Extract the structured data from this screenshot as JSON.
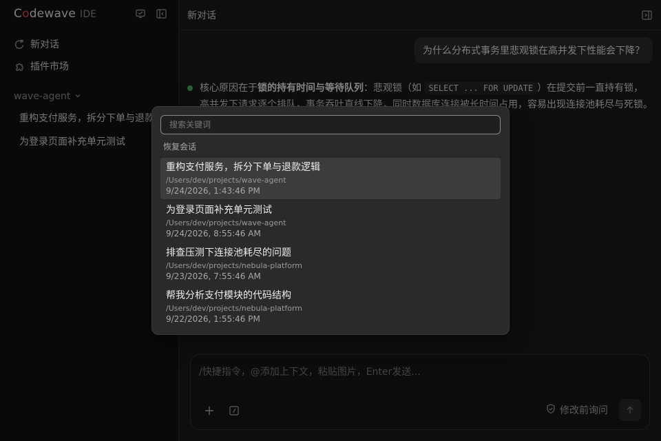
{
  "app": {
    "logo_c": "C",
    "logo_o": "o",
    "logo_rest": "dewave",
    "logo_suffix": "IDE"
  },
  "sidebar": {
    "nav": [
      {
        "label": "新对话",
        "icon": "new-chat-icon"
      },
      {
        "label": "插件市场",
        "icon": "puzzle-icon"
      }
    ],
    "project": "wave-agent",
    "sessions": [
      "重构支付服务，拆分下单与退款逻辑",
      "为登录页面补充单元测试"
    ]
  },
  "topbar": {
    "title": "新对话"
  },
  "chat": {
    "user_message": "为什么分布式事务里悲观锁在高并发下性能会下降？",
    "assistant": {
      "lead": "核心原因在于",
      "bold": "锁的持有时间与等待队列",
      "mid": "：悲观锁（如 ",
      "code": "SELECT ... FOR UPDATE",
      "tail": "）在提交前一直持有锁，高并发下请求逐个排队，事务吞吐直线下降，同时数据库连接被长时间占用，容易出现连接池耗尽与死锁。"
    }
  },
  "composer": {
    "placeholder": "/快捷指令，@添加上下文，粘贴图片，Enter发送...",
    "mode_label": "修改前询问"
  },
  "modal": {
    "search_placeholder": "搜索关键词",
    "section_label": "恢复会话",
    "items": [
      {
        "title": "重构支付服务，拆分下单与退款逻辑",
        "path": "/Users/dev/projects/wave-agent",
        "date": "9/24/2026, 1:43:46 PM"
      },
      {
        "title": "为登录页面补充单元测试",
        "path": "/Users/dev/projects/wave-agent",
        "date": "9/24/2026, 8:55:46 AM"
      },
      {
        "title": "排查压测下连接池耗尽的问题",
        "path": "/Users/dev/projects/nebula-platform",
        "date": "9/23/2026, 7:55:46 AM"
      },
      {
        "title": "帮我分析支付模块的代码结构",
        "path": "/Users/dev/projects/nebula-platform",
        "date": "9/22/2026, 1:55:46 PM"
      }
    ]
  },
  "colors": {
    "accent_red": "#e5484d",
    "status_green": "#4caf72",
    "background": "#1a1a1a"
  }
}
